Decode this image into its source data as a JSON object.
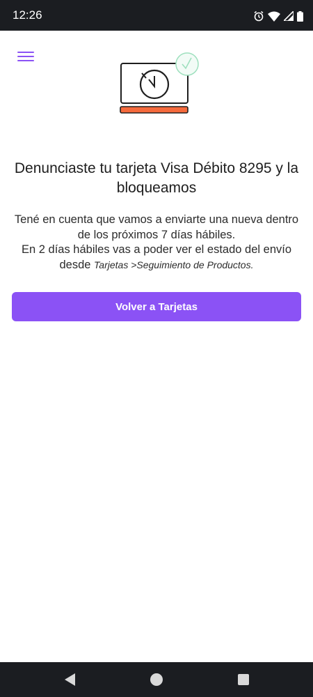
{
  "status_bar": {
    "time": "12:26",
    "icons": [
      "alarm-icon",
      "wifi-icon",
      "signal-icon",
      "battery-icon"
    ]
  },
  "header": {
    "menu_icon": "hamburger-menu-icon"
  },
  "illustration": {
    "name": "card-clock-check-illustration",
    "accent": "#f56a3c"
  },
  "content": {
    "title": "Denunciaste tu tarjeta Visa Débito 8295 y la bloqueamos",
    "desc_line1": "Tené en cuenta que vamos a enviarte una nueva dentro de los próximos 7 días hábiles.",
    "desc_line2_prefix": "En 2 días hábiles vas a poder ver el estado del envío desde ",
    "desc_line2_path": "Tarjetas >Seguimiento de Productos."
  },
  "actions": {
    "back_to_cards_label": "Volver a Tarjetas"
  },
  "colors": {
    "primary": "#8b52f5",
    "system_bar": "#1b1d21"
  },
  "nav_bar": {
    "buttons": [
      "back-icon",
      "home-icon",
      "recents-icon"
    ]
  }
}
